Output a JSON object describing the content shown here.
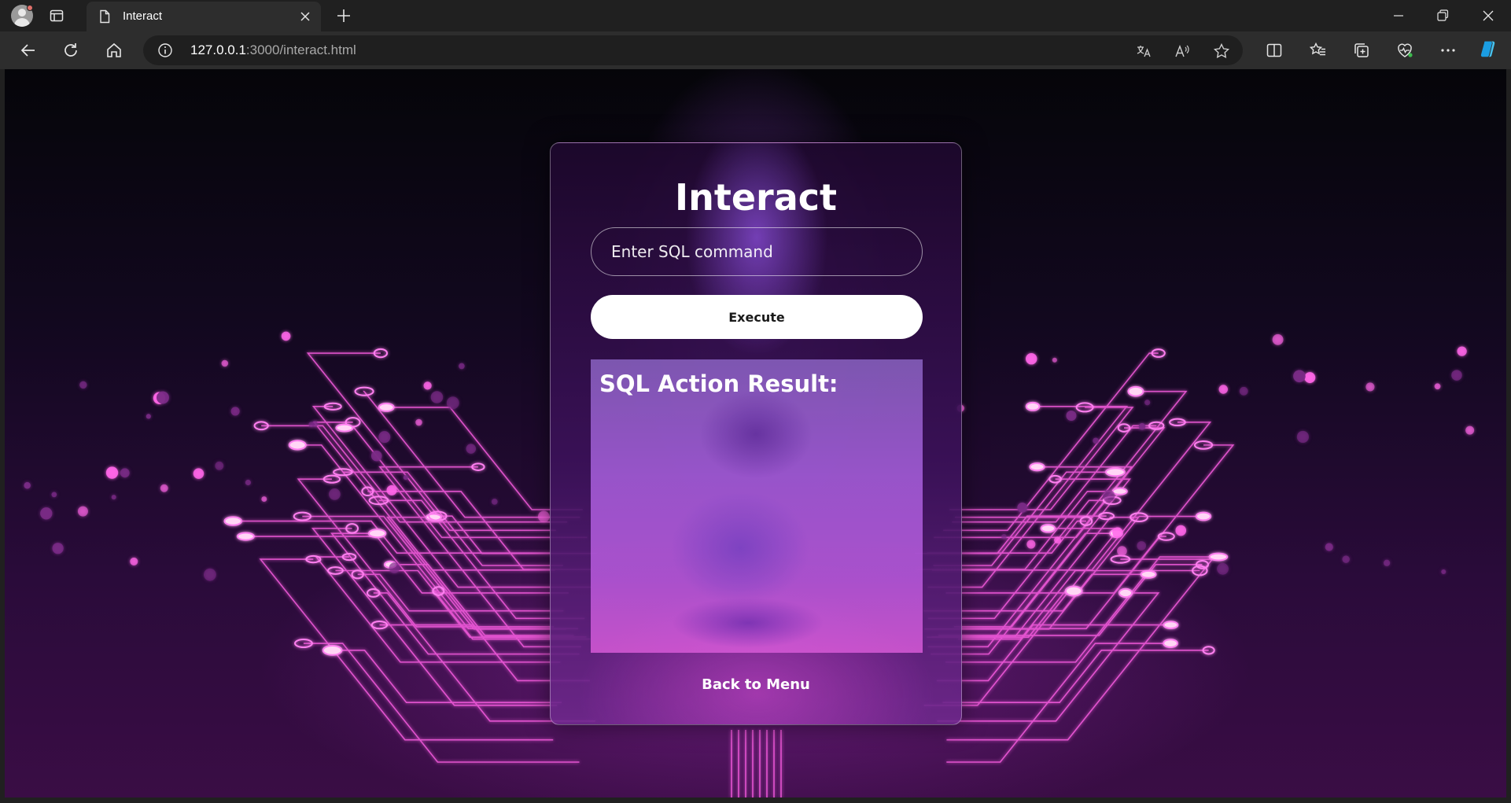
{
  "browser": {
    "tab_title": "Interact",
    "url_host": "127.0.0.1",
    "url_rest": ":3000/interact.html"
  },
  "page": {
    "title": "Interact",
    "sql_input": {
      "placeholder": "Enter SQL command",
      "value": ""
    },
    "execute_label": "Execute",
    "result_title": "SQL Action Result:",
    "result_text": "",
    "back_link": "Back to Menu"
  },
  "colors": {
    "accent_magenta": "#e040c8",
    "card_border": "#ffffff",
    "button_bg": "#ffffff"
  },
  "icons": {
    "titlebar": [
      "profile-icon",
      "tab-actions-icon",
      "page-icon",
      "close-icon",
      "new-tab-icon",
      "minimize-icon",
      "restore-icon",
      "window-close-icon"
    ],
    "toolbar": [
      "back-icon",
      "refresh-icon",
      "home-icon",
      "info-icon",
      "translate-icon",
      "read-aloud-icon",
      "favorite-star-icon",
      "split-screen-icon",
      "favorites-icon",
      "collections-icon",
      "browser-essentials-icon",
      "more-icon",
      "copilot-icon"
    ]
  }
}
